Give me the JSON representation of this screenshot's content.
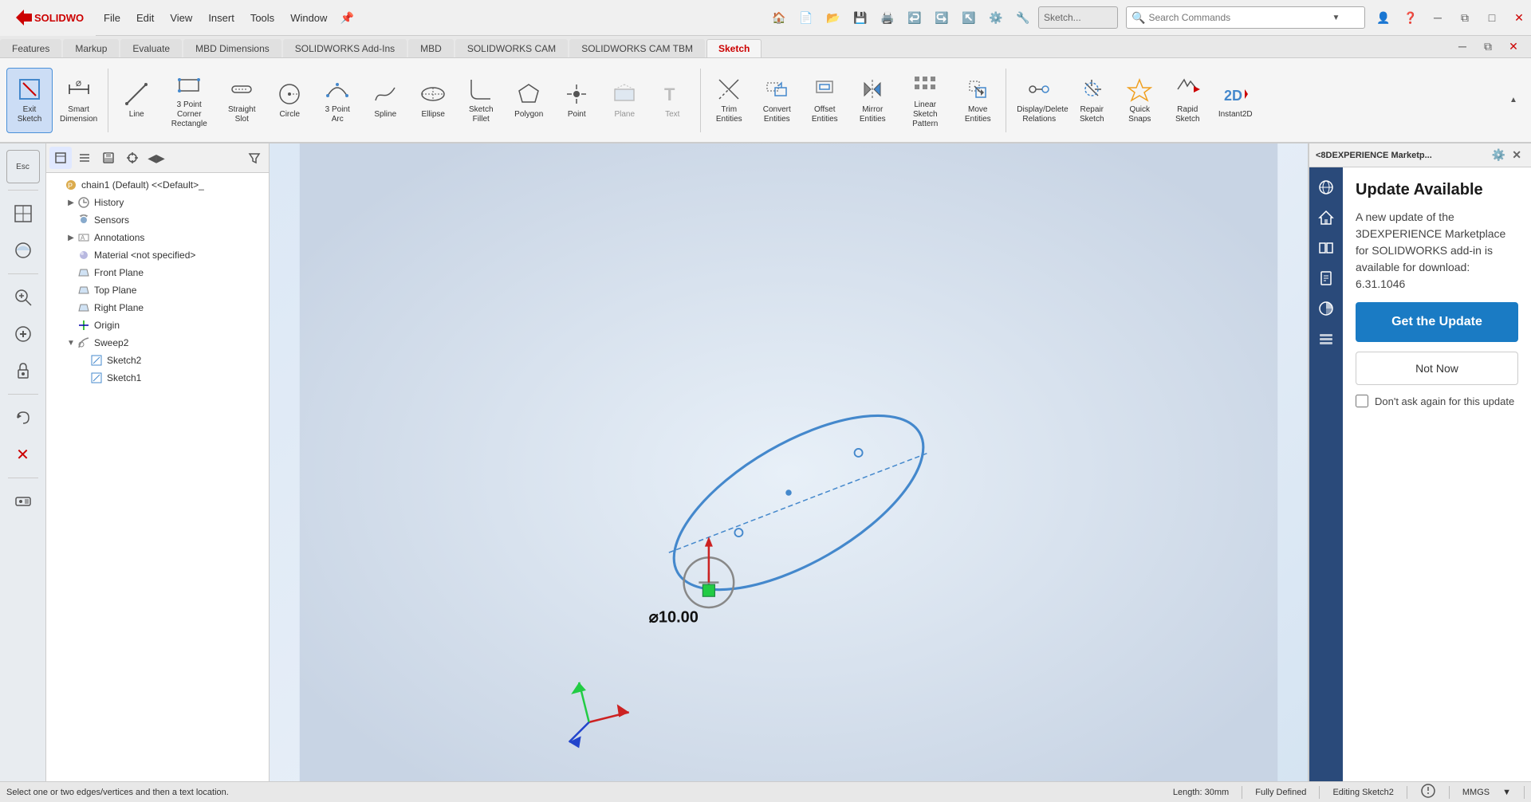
{
  "app": {
    "title": "SOLIDWORKS",
    "logo": "SOLIDWORKS"
  },
  "titlebar": {
    "menu_items": [
      "File",
      "Edit",
      "View",
      "Insert",
      "Tools",
      "Window"
    ],
    "search_placeholder": "Search Commands",
    "window_controls": [
      "minimize",
      "restore",
      "maximize",
      "close"
    ]
  },
  "ribbon": {
    "tabs": [
      {
        "label": "Features",
        "active": false
      },
      {
        "label": "Markup",
        "active": false
      },
      {
        "label": "Evaluate",
        "active": false
      },
      {
        "label": "MBD Dimensions",
        "active": false
      },
      {
        "label": "SOLIDWORKS Add-Ins",
        "active": false
      },
      {
        "label": "MBD",
        "active": false
      },
      {
        "label": "SOLIDWORKS CAM",
        "active": false
      },
      {
        "label": "SOLIDWORKS CAM TBM",
        "active": false
      },
      {
        "label": "Sketch",
        "active": true
      }
    ],
    "tools": [
      {
        "id": "exit-sketch",
        "label": "Exit\nSketch",
        "active": true
      },
      {
        "id": "smart-dimension",
        "label": "Smart\nDimension"
      },
      {
        "id": "line",
        "label": "Line"
      },
      {
        "id": "3pt-corner-rect",
        "label": "3 Point Corner\nRectangle"
      },
      {
        "id": "straight-slot",
        "label": "Straight\nSlot"
      },
      {
        "id": "circle",
        "label": "Circle"
      },
      {
        "id": "3pt-arc",
        "label": "3 Point\nArc"
      },
      {
        "id": "spline",
        "label": "Spline"
      },
      {
        "id": "ellipse",
        "label": "Ellipse"
      },
      {
        "id": "sketch-fillet",
        "label": "Sketch\nFillet"
      },
      {
        "id": "polygon",
        "label": "Polygon"
      },
      {
        "id": "point",
        "label": "Point"
      },
      {
        "id": "plane",
        "label": "Plane"
      },
      {
        "id": "text",
        "label": "Text"
      },
      {
        "id": "trim-entities",
        "label": "Trim\nEntities"
      },
      {
        "id": "convert-entities",
        "label": "Convert\nEntities"
      },
      {
        "id": "offset-entities",
        "label": "Offset\nEntities"
      },
      {
        "id": "mirror-entities",
        "label": "Mirror\nEntities"
      },
      {
        "id": "linear-sketch-pattern",
        "label": "Linear Sketch\nPattern"
      },
      {
        "id": "move-entities",
        "label": "Move\nEntities"
      },
      {
        "id": "display-delete-relations",
        "label": "Display/Delete\nRelations"
      },
      {
        "id": "repair-sketch",
        "label": "Repair\nSketch"
      },
      {
        "id": "quick-snaps",
        "label": "Quick\nSnaps"
      },
      {
        "id": "rapid-sketch",
        "label": "Rapid\nSketch"
      },
      {
        "id": "instant2d",
        "label": "Instant2D"
      }
    ]
  },
  "feature_tree": {
    "root": "chain1 (Default) <<Default>_",
    "items": [
      {
        "id": "history",
        "label": "History",
        "icon": "history",
        "expanded": false,
        "indent": 0
      },
      {
        "id": "sensors",
        "label": "Sensors",
        "icon": "sensor",
        "expanded": false,
        "indent": 0
      },
      {
        "id": "annotations",
        "label": "Annotations",
        "icon": "annotation",
        "expanded": false,
        "indent": 0
      },
      {
        "id": "material",
        "label": "Material <not specified>",
        "icon": "material",
        "expanded": false,
        "indent": 0
      },
      {
        "id": "front-plane",
        "label": "Front Plane",
        "icon": "plane",
        "expanded": false,
        "indent": 0
      },
      {
        "id": "top-plane",
        "label": "Top Plane",
        "icon": "plane",
        "expanded": false,
        "indent": 0
      },
      {
        "id": "right-plane",
        "label": "Right Plane",
        "icon": "plane",
        "expanded": false,
        "indent": 0
      },
      {
        "id": "origin",
        "label": "Origin",
        "icon": "origin",
        "expanded": false,
        "indent": 0
      },
      {
        "id": "sweep2",
        "label": "Sweep2",
        "icon": "sweep",
        "expanded": true,
        "indent": 0
      },
      {
        "id": "sketch2",
        "label": "Sketch2",
        "icon": "sketch",
        "expanded": false,
        "indent": 1
      },
      {
        "id": "sketch1",
        "label": "Sketch1",
        "icon": "sketch",
        "expanded": false,
        "indent": 1
      }
    ]
  },
  "right_panel": {
    "title": "<8DEXPERIENCE Marketp...",
    "update_title": "Update Available",
    "update_description": "A new update of the 3DEXPERIENCE Marketplace for SOLIDWORKS add-in is available for download: 6.31.1046",
    "get_update_label": "Get the Update",
    "not_now_label": "Not Now",
    "dont_ask_label": "Don't ask again for this update"
  },
  "statusbar": {
    "message": "Select one or two edges/vertices and then a text location.",
    "length": "Length: 30mm",
    "defined": "Fully Defined",
    "editing": "Editing Sketch2",
    "units": "MMGS"
  },
  "viewport_toolbar": {
    "buttons": [
      "zoom-to-fit",
      "zoom-to-area",
      "pan",
      "rotate",
      "view-orient",
      "section-view",
      "display-style",
      "lighting",
      "scene",
      "hide-show",
      "view-settings"
    ]
  },
  "colors": {
    "accent_blue": "#1a7bc4",
    "solidworks_red": "#cc0000",
    "panel_bg": "#2a4a7a",
    "sketch_color": "#4488cc",
    "viewport_bg": "#dce8f5"
  }
}
